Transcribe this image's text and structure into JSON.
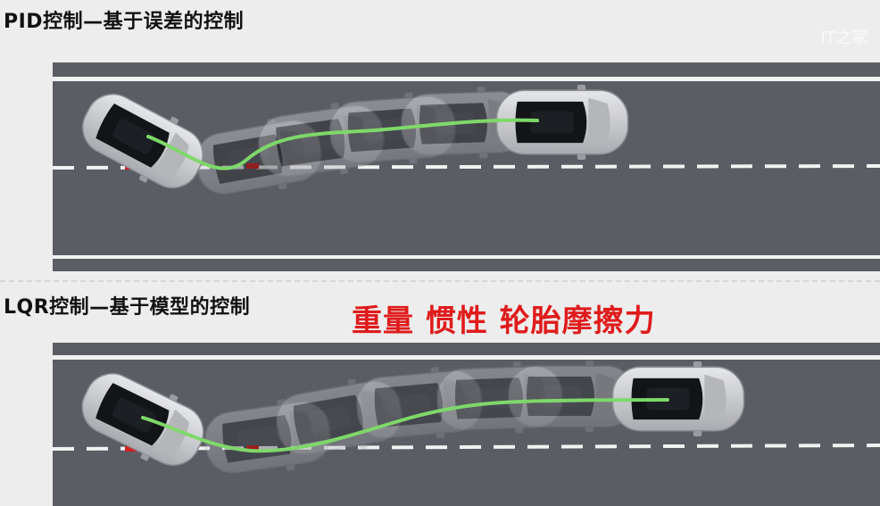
{
  "sections": [
    {
      "title": "PID控制—基于误差的控制"
    },
    {
      "title": "LQR控制—基于模型的控制"
    }
  ],
  "highlight": "重量 惯性 轮胎摩擦力",
  "watermark": "IT之家",
  "colors": {
    "background": "#ededed",
    "road": "#5b5d65",
    "lane_line": "#f2f2f2",
    "trajectory": "#7fd86a",
    "highlight_text": "#e01b1b",
    "car_body": "#d4d5d8"
  }
}
